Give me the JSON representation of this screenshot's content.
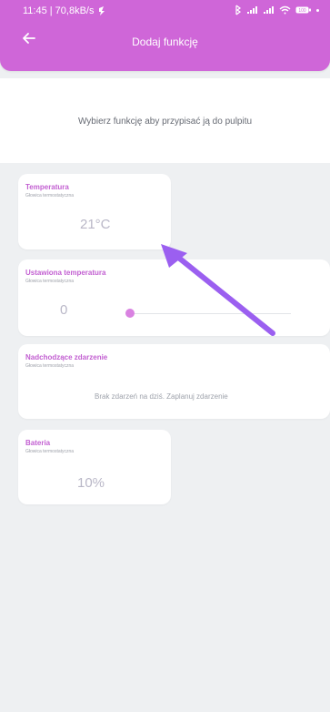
{
  "status_bar": {
    "time_speed": "11:45 | 70,8kB/s",
    "battery_label": "100"
  },
  "header": {
    "title": "Dodaj funkcję"
  },
  "intro": {
    "text": "Wybierz funkcję aby przypisać ją do pulpitu"
  },
  "cards": [
    {
      "title": "Temperatura",
      "subtitle": "Głowica termostatyczna",
      "value": "21°C"
    },
    {
      "title": "Ustawiona temperatura",
      "subtitle": "Głowica termostatyczna",
      "value": "0"
    },
    {
      "title": "Nadchodzące zdarzenie",
      "subtitle": "Głowica termostatyczna",
      "message": "Brak zdarzeń na dziś. Zaplanuj zdarzenie"
    },
    {
      "title": "Bateria",
      "subtitle": "Głowica termostatyczna",
      "value": "10%"
    }
  ],
  "colors": {
    "header_bg": "#cf66d8",
    "accent": "#c25fd1",
    "arrow": "#9b5ff0",
    "background": "#eef0f2"
  },
  "icons": {
    "back": "back-arrow-icon",
    "charging": "charging-icon",
    "bluetooth": "bluetooth-icon",
    "signal": "signal-icon",
    "wifi": "wifi-icon",
    "battery": "battery-icon"
  },
  "slider": {
    "value_fraction": 0
  }
}
